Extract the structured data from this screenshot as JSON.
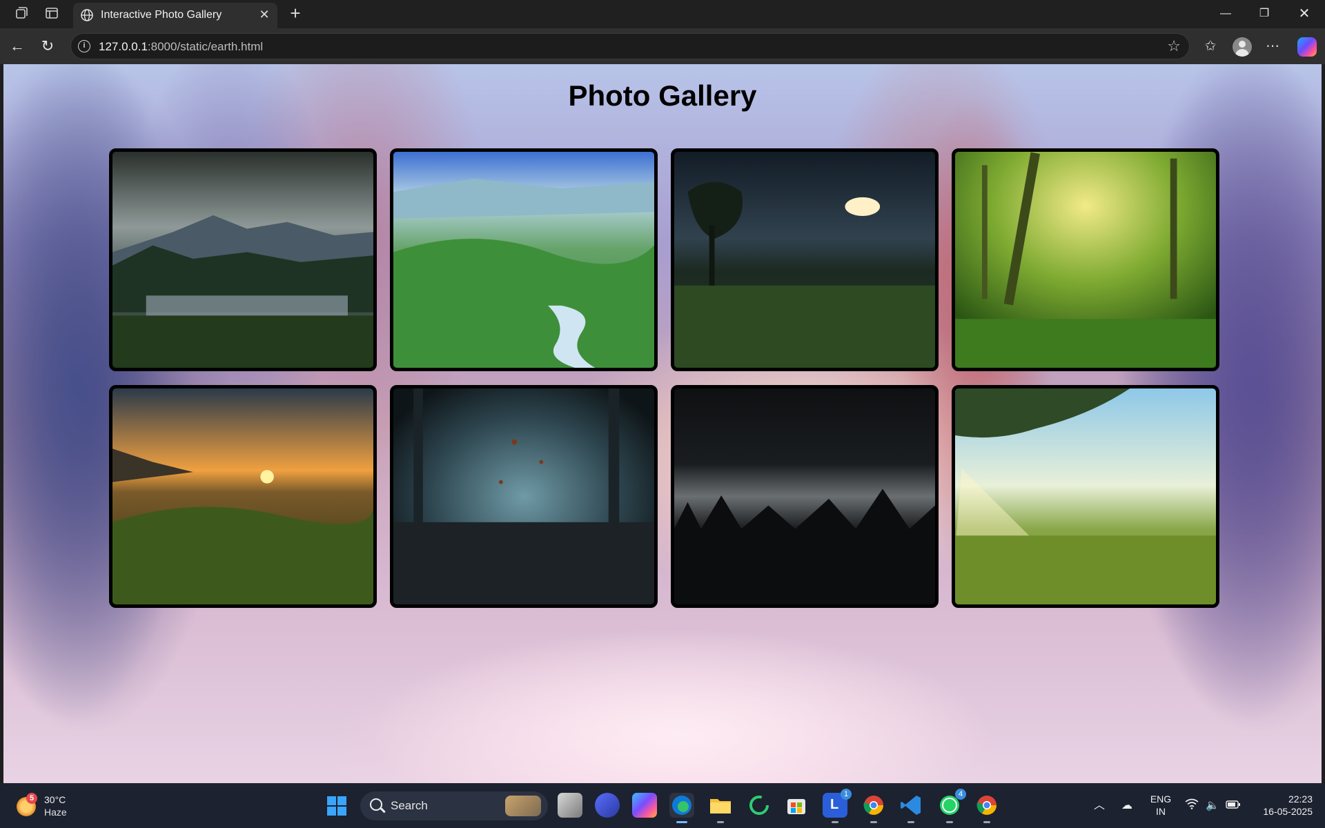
{
  "browser": {
    "tab_title": "Interactive Photo Gallery",
    "url_host": "127.0.0.1",
    "url_path": ":8000/static/earth.html"
  },
  "page": {
    "title": "Photo Gallery",
    "photos": [
      {
        "alt": "Stormy mountain lake"
      },
      {
        "alt": "Misty green valley with stream"
      },
      {
        "alt": "Moonlit meadow with tree"
      },
      {
        "alt": "Sunlit green forest"
      },
      {
        "alt": "Sunset over grassy field"
      },
      {
        "alt": "Dark forest with falling leaves"
      },
      {
        "alt": "Foggy dark pine forest"
      },
      {
        "alt": "Sun rays through pine trees over field"
      }
    ]
  },
  "taskbar": {
    "weather_badge": "5",
    "weather_temp": "30°C",
    "weather_cond": "Haze",
    "search_label": "Search",
    "teams_badge": "1",
    "whatsapp_badge": "4",
    "lang_line1": "ENG",
    "lang_line2": "IN",
    "time": "22:23",
    "date": "16-05-2025"
  }
}
